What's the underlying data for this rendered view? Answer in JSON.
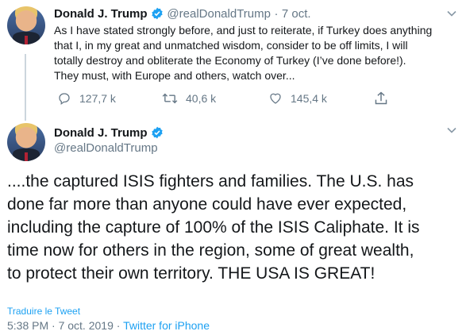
{
  "tweet1": {
    "name": "Donald J. Trump",
    "handle": "@realDonaldTrump",
    "separator": "·",
    "date": "7 oct.",
    "text_lines": [
      "As I have stated strongly before, and just to reiterate, if Turkey does anything",
      "that I, in my great and unmatched wisdom, consider to be off limits, I will",
      "totally destroy and obliterate the Economy of Turkey (I’ve done before!).",
      "They must, with Europe and others, watch over..."
    ],
    "replies": "127,7 k",
    "retweets": "40,6 k",
    "likes": "145,4 k"
  },
  "tweet2": {
    "name": "Donald J. Trump",
    "handle": "@realDonaldTrump",
    "text_lines": [
      "....the captured ISIS fighters and families. The U.S. has",
      "done far more than anyone could have ever expected,",
      "including the capture of 100% of the ISIS Caliphate. It is",
      "time now for others in the region, some of great wealth,",
      "to protect their own territory. THE USA IS GREAT!"
    ],
    "translate": "Traduire le Tweet",
    "time": "5:38 PM · 7 oct. 2019",
    "dot": "·",
    "source": "Twitter for iPhone"
  },
  "colors": {
    "accent": "#1da1f2",
    "muted": "#657786",
    "text": "#14171a"
  },
  "icons": [
    "verified-badge-icon",
    "chevron-down-icon",
    "reply-icon",
    "retweet-icon",
    "like-icon",
    "share-icon"
  ]
}
